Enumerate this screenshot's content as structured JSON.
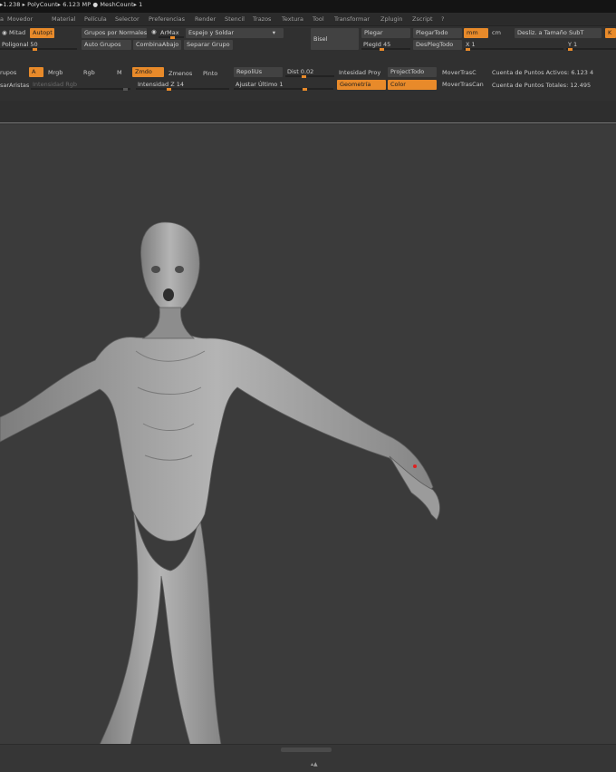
{
  "info_bar": "▸1.238 ▸ PolyCount▸ 6.123 MP  ● MeshCount▸ 1",
  "menu": [
    "a",
    "Movedor",
    "Material",
    "Película",
    "Selector",
    "Preferencias",
    "Render",
    "Stencil",
    "Trazos",
    "Textura",
    "Tool",
    "Transformar",
    "Zplugin",
    "Zscript",
    "?"
  ],
  "row1": {
    "mitad": "Mitad",
    "autopt": "Autopt",
    "grupos_normales": "Grupos por Normales",
    "armax": "ArMax",
    "dropdown": "Espejo y Soldar",
    "bisel": "Bisel",
    "plegar": "Plegar",
    "plegar_todo": "PlegarTodo",
    "mm": "mm",
    "cm": "cm",
    "desliz": "Desliz. a Tamaño SubT",
    "k": "K"
  },
  "row2": {
    "poligonal": "Poligonal 50",
    "auto_grupos": "Auto Grupos",
    "combina": "CombinaAbajo",
    "separar": "Separar Grupo",
    "pleg_id": "PlegId 45",
    "des_pleg": "DesPlegTodo",
    "x1": "X 1",
    "y1": "Y 1"
  },
  "row3": {
    "grupos": "rupos",
    "a": "A",
    "mrgb": "Mrgb",
    "rgb": "Rgb",
    "m": "M",
    "zmdo": "Zmdo",
    "zmenos": "Zmenos",
    "pinto": "Pinto",
    "repoli": "RepoliUs",
    "dist": "Dist 0.02",
    "intensidad_proy": "Intesidad Proy",
    "project_todo": "ProjectTodo",
    "mover_trasc": "MoverTrasC",
    "cuenta_activos": "Cuenta de Puntos Activos: 6.123 4"
  },
  "row4": {
    "aristas": "sarAristas",
    "intensidad_rgb": "Intensidad Rgb",
    "intensidad_z": "Intensidad Z 14",
    "ajustar": "Ajustar Último 1",
    "geometria": "Geometría",
    "color": "Color",
    "mover_trasc_cap": "MoverTrasCan",
    "cuenta_totales": "Cuenta de Puntos Totales: 12.495"
  },
  "bottom_indicator": "▴▲"
}
